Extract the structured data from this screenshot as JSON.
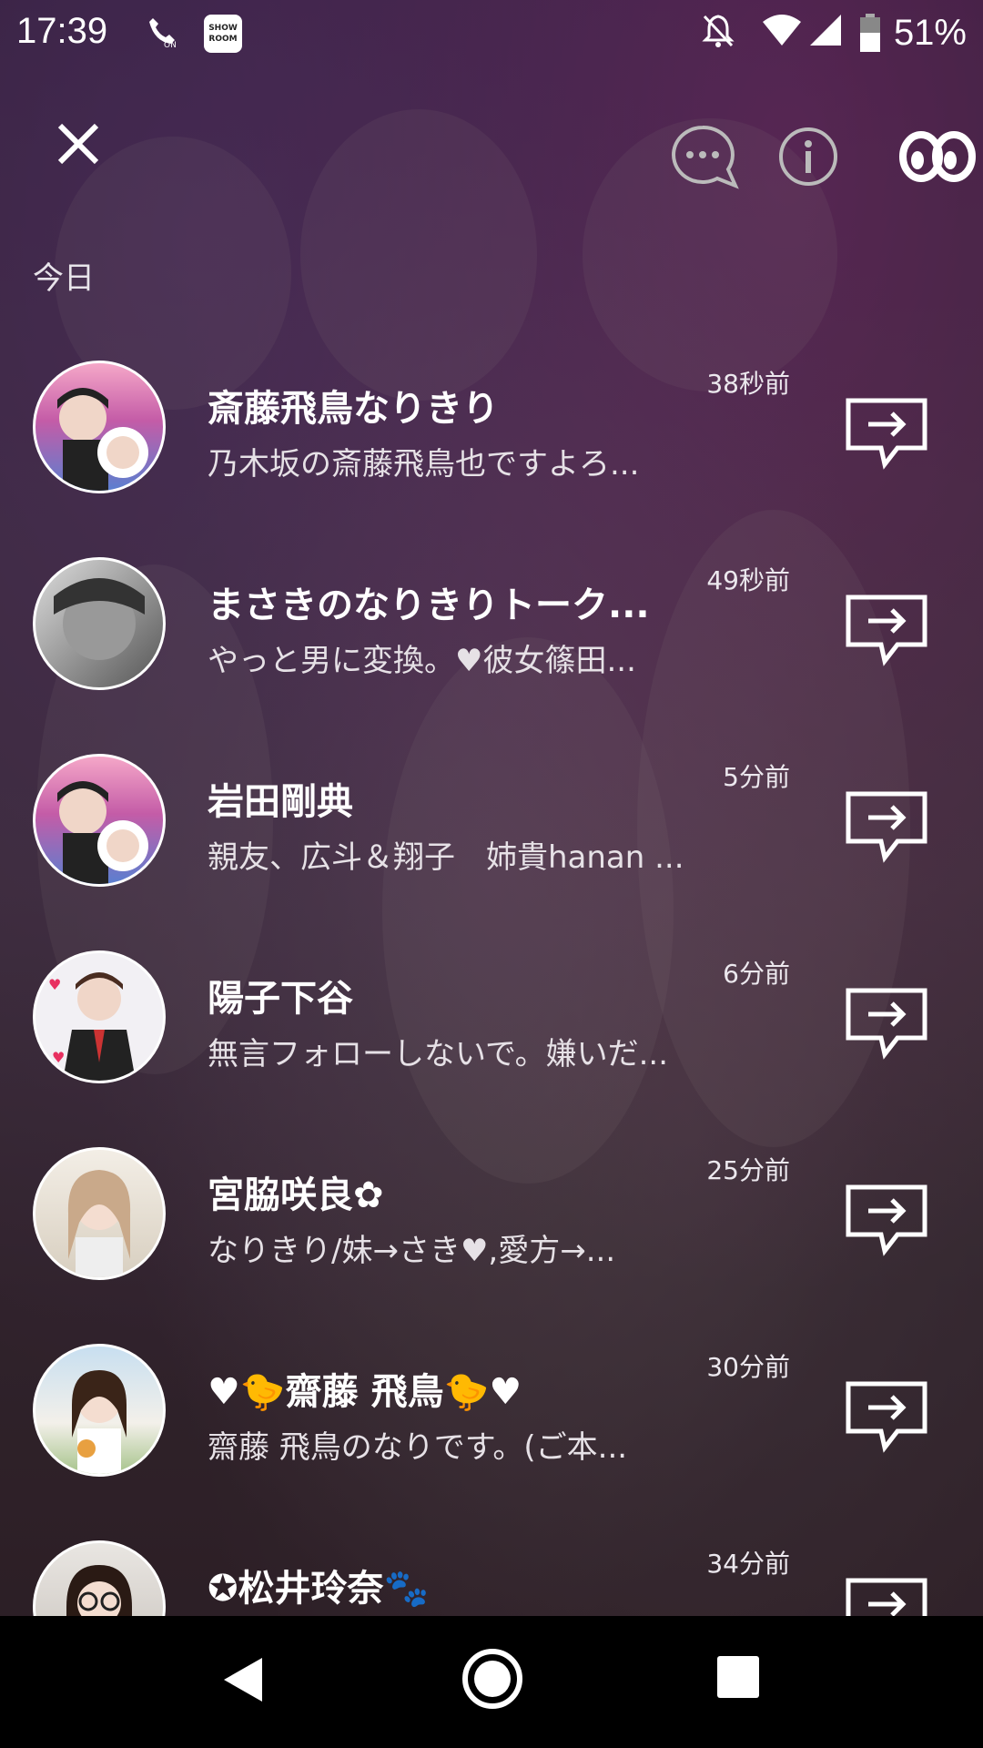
{
  "status_bar": {
    "time": "17:39",
    "battery": "51%"
  },
  "section": "今日",
  "rows": [
    {
      "name": "斎藤飛鳥なりきり",
      "message": "乃木坂の斎藤飛鳥也ですよろ...",
      "ago": "38秒前"
    },
    {
      "name": "まさきのなりきりトーク...",
      "message": "やっと男に変換。♥彼女篠田...",
      "ago": "49秒前"
    },
    {
      "name": "岩田剛典",
      "message": "親友、広斗＆翔子　姉貴hanan ...",
      "ago": "5分前"
    },
    {
      "name": "陽子下谷",
      "message": "無言フォローしないで。嫌いだ...",
      "ago": "6分前"
    },
    {
      "name": "宮脇咲良✿",
      "message": "なりきり/妹→さき♥,愛方→...",
      "ago": "25分前"
    },
    {
      "name": "♥🐤齋藤 飛鳥🐤♥",
      "message": "齋藤 飛鳥のなりです。(ご本...",
      "ago": "30分前"
    },
    {
      "name": "✪松井玲奈🐾",
      "message": "",
      "ago": "34分前"
    }
  ],
  "colors": {
    "accent": "#e8307a",
    "background": "#3a2b3c"
  }
}
